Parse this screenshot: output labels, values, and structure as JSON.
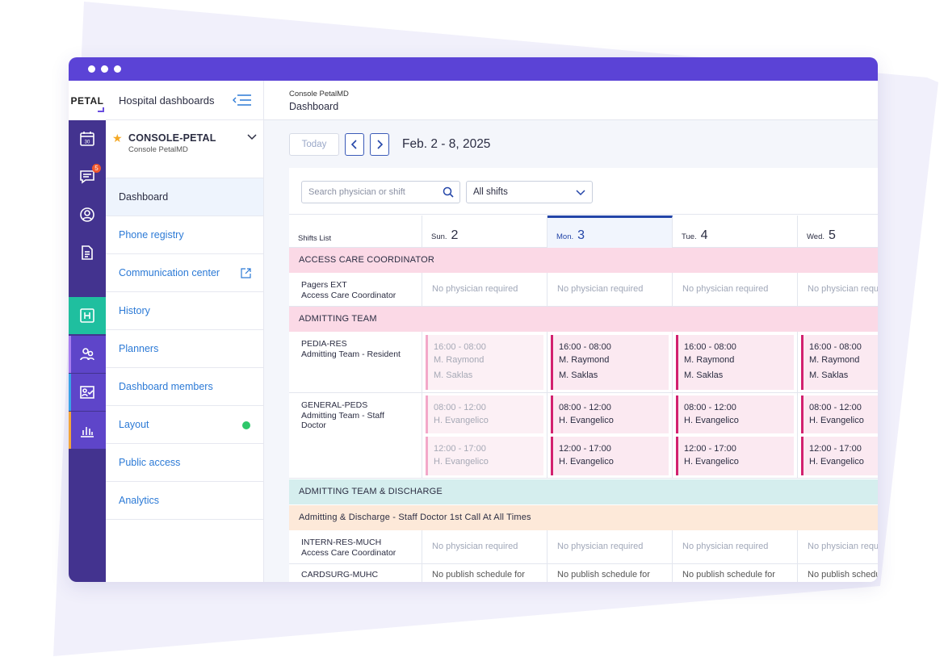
{
  "app": {
    "logo": "PETAL",
    "panel_title": "Hospital dashboards"
  },
  "rail": {
    "calendar_day": "30",
    "messages_badge": "5"
  },
  "console": {
    "name": "CONSOLE-PETAL",
    "subtitle": "Console PetalMD"
  },
  "nav": [
    {
      "label": "Dashboard"
    },
    {
      "label": "Phone registry"
    },
    {
      "label": "Communication center"
    },
    {
      "label": "History"
    },
    {
      "label": "Planners"
    },
    {
      "label": "Dashboard members"
    },
    {
      "label": "Layout"
    },
    {
      "label": "Public access"
    },
    {
      "label": "Analytics"
    }
  ],
  "header": {
    "breadcrumb": "Console PetalMD",
    "title": "Dashboard"
  },
  "toolbar": {
    "today_label": "Today",
    "date_range": "Feb. 2 - 8, 2025"
  },
  "filters": {
    "search_placeholder": "Search physician or shift",
    "select_value": "All shifts"
  },
  "grid": {
    "first_col": "Shifts List",
    "days": [
      {
        "name": "Sun.",
        "num": "2"
      },
      {
        "name": "Mon.",
        "num": "3"
      },
      {
        "name": "Tue.",
        "num": "4"
      },
      {
        "name": "Wed.",
        "num": "5"
      }
    ],
    "no_physician": "No physician required",
    "no_physician_cut": "No physician requ",
    "groups": {
      "g1": "ACCESS CARE COORDINATOR",
      "g2": "ADMITTING TEAM",
      "g3": "ADMITTING TEAM & DISCHARGE",
      "g4": "Admitting & Discharge - Staff Doctor 1st Call At All Times"
    },
    "rows": {
      "r1": {
        "code": "Pagers EXT",
        "name": "Access Care Coordinator"
      },
      "r2": {
        "code": "PEDIA-RES",
        "name": "Admitting Team - Resident"
      },
      "r3": {
        "code": "GENERAL-PEDS",
        "name": "Admitting Team - Staff",
        "name2": "Doctor"
      },
      "r4": {
        "code": "INTERN-RES-MUCH",
        "name": "Access Care Coordinator"
      },
      "r5": {
        "code": "CARDSURG-MUHC",
        "cell_text": "No publish schedule for"
      }
    },
    "shifts": {
      "night": {
        "time": "16:00 - 08:00",
        "doc1": "M. Raymond",
        "doc2": "M. Saklas"
      },
      "morning": {
        "time": "08:00 - 12:00",
        "doc": "H. Evangelico"
      },
      "afternoon": {
        "time": "12:00 - 17:00",
        "doc": "H. Evangelico"
      }
    }
  }
}
